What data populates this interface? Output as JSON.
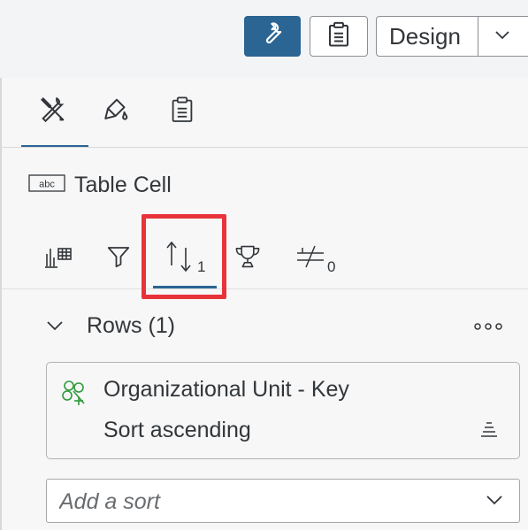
{
  "toolbar": {
    "icons": {
      "wrench": "wrench-icon",
      "clipboard": "clipboard-icon",
      "caret": "chevron-down-icon"
    },
    "mode_label": "Design",
    "accent_color": "#2b6594"
  },
  "panel_tabs": {
    "icons": [
      "tools-icon",
      "paint-brush-icon",
      "clipboard-icon"
    ],
    "active_index": 0
  },
  "selection": {
    "icon": "text-field-icon",
    "label": "Table Cell"
  },
  "sub_tabs": {
    "icons": [
      "bar-chart-icon",
      "filter-icon",
      "sort-icon",
      "trophy-icon",
      "exception-icon"
    ],
    "sort_badge": "1",
    "exception_badge": "0",
    "active_index": 2,
    "highlight_color": "#e8333a"
  },
  "rows_section": {
    "title": "Rows (1)",
    "more_icon": "more-icon"
  },
  "sort_item": {
    "icon": "hierarchy-icon",
    "icon_color": "#2e9a3a",
    "title": "Organizational Unit - Key",
    "order": "Sort ascending"
  },
  "add_sort": {
    "placeholder": "Add a sort"
  }
}
